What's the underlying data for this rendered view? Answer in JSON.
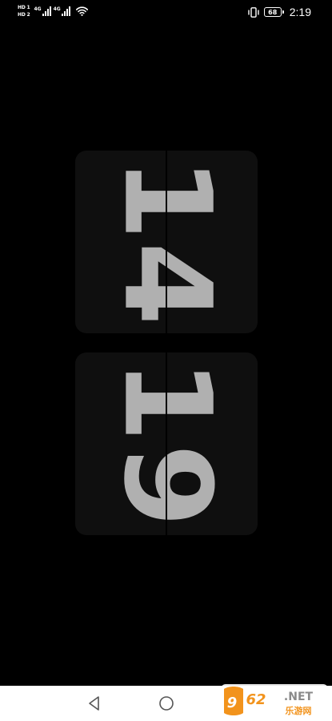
{
  "status_bar": {
    "sim1_badge": "HD 1",
    "sim2_badge": "HD 2",
    "network1_label": "4G",
    "network2_label": "4G",
    "battery_level": "68",
    "time": "2:19",
    "icons": [
      "signal-bars-icon",
      "signal-bars-icon",
      "wifi-icon",
      "vibrate-icon",
      "battery-icon"
    ]
  },
  "clock": {
    "hours": "14",
    "minutes": "19"
  },
  "nav_bar": {
    "icons": [
      "back-icon",
      "home-icon"
    ]
  },
  "watermark": {
    "text": "962.NET",
    "subtext": "乐游网"
  },
  "colors": {
    "background": "#000000",
    "card": "#0f0f0f",
    "digit": "#b0b0b0",
    "nav_bar": "#ffffff",
    "logo_orange": "#f2931c"
  }
}
